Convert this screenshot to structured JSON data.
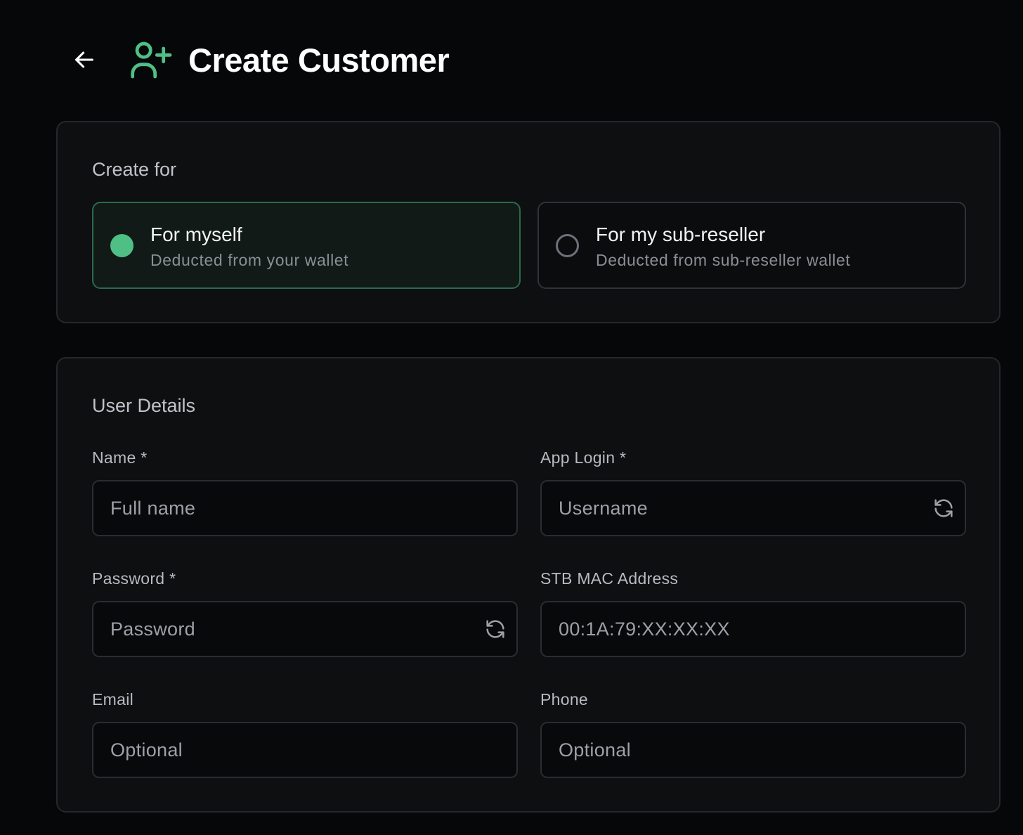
{
  "header": {
    "title": "Create Customer",
    "back_icon": "arrow-left-icon",
    "title_icon": "user-plus-icon"
  },
  "colors": {
    "accent": "#4fbf86",
    "background": "#060708",
    "card": "#0e0f11"
  },
  "create_for": {
    "title": "Create for",
    "options": [
      {
        "title": "For myself",
        "subtitle": "Deducted from your wallet",
        "selected": true
      },
      {
        "title": "For my sub-reseller",
        "subtitle": "Deducted from sub-reseller wallet",
        "selected": false
      }
    ]
  },
  "user_details": {
    "title": "User Details",
    "fields": {
      "name": {
        "label": "Name *",
        "placeholder": "Full name"
      },
      "app_login": {
        "label": "App Login *",
        "placeholder": "Username",
        "icon": "refresh-icon"
      },
      "password": {
        "label": "Password *",
        "placeholder": "Password",
        "icon": "refresh-icon"
      },
      "mac": {
        "label": "STB MAC Address",
        "placeholder": "00:1A:79:XX:XX:XX"
      },
      "email": {
        "label": "Email",
        "placeholder": "Optional"
      },
      "phone": {
        "label": "Phone",
        "placeholder": "Optional"
      }
    }
  }
}
